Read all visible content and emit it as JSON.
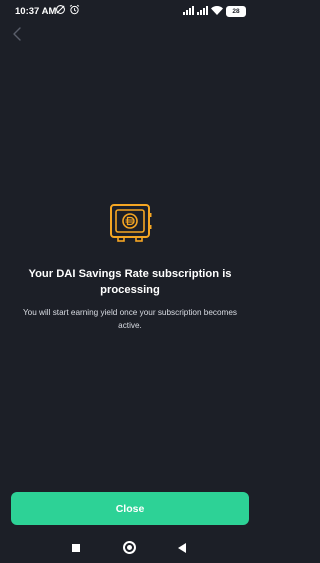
{
  "status_bar": {
    "time": "10:37 AM",
    "battery": "28",
    "left_icons": [
      "screen-rotate-icon",
      "alarm-clock-icon"
    ],
    "right_icons": [
      "signal-icon",
      "signal-icon",
      "wifi-icon",
      "battery-icon"
    ]
  },
  "header": {
    "back_icon": "chevron-left-icon"
  },
  "main": {
    "illustration_icon": "dai-safe-icon",
    "title": "Your DAI Savings Rate subscription is processing",
    "subtitle": "You will start earning yield once your subscription becomes active."
  },
  "footer": {
    "close_label": "Close"
  },
  "colors": {
    "background": "#1c1f27",
    "accent_green": "#2dd296",
    "illustration_orange": "#f5a623",
    "back_icon": "#5a5f6b"
  },
  "nav_bar": {
    "icons": [
      "recents-icon",
      "home-icon",
      "back-icon"
    ]
  }
}
